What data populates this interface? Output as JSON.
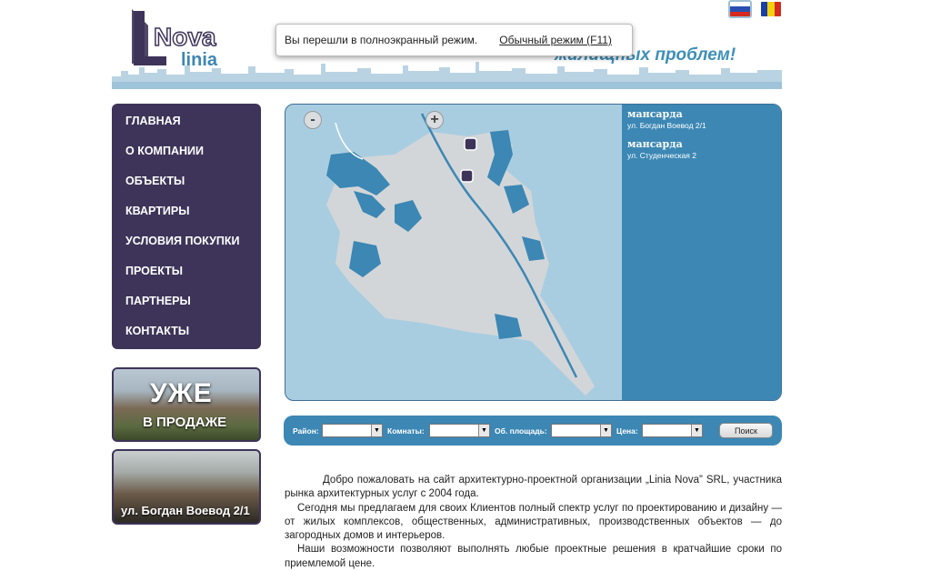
{
  "browser": {
    "fullscreen_notice": "Вы перешли в полноэкранный режим.",
    "normal_mode_link": "Обычный режим (F11)"
  },
  "header": {
    "logo_alt": "Nova Linia",
    "slogan": "жилищных проблем!",
    "languages": [
      "ru",
      "md"
    ]
  },
  "menu": {
    "items": [
      "ГЛАВНАЯ",
      "О КОМПАНИИ",
      "ОБЪЕКТЫ",
      "КВАРТИРЫ",
      "УСЛОВИЯ ПОКУПКИ",
      "ПРОЕКТЫ",
      "ПАРТНЕРЫ",
      "КОНТАКТЫ"
    ]
  },
  "banners": {
    "sale_line1": "УЖЕ",
    "sale_line2": "В ПРОДАЖЕ",
    "object_address": "ул. Богдан Воевод 2/1"
  },
  "map": {
    "zoom_out": "-",
    "zoom_in": "+",
    "objects": [
      {
        "title": "мансарда",
        "address": "ул. Богдан Воевод 2/1"
      },
      {
        "title": "мансарда",
        "address": "ул. Студенческая 2"
      }
    ]
  },
  "search": {
    "district_label": "Район:",
    "rooms_label": "Комнаты:",
    "area_label": "Об. площадь:",
    "price_label": "Цена:",
    "button": "Поиск",
    "district_value": "",
    "rooms_value": "",
    "area_value": "",
    "price_value": ""
  },
  "content": {
    "p1": "Добро пожаловать на сайт архитектурно-проектной организации „Linia Nova” SRL, участника рынка архитектурных услуг с 2004 года.",
    "p2": "Сегодня мы предлагаем для своих Клиентов полный спектр услуг по проектированию и дизайну — от жилых комплексов, общественных, административных, производственных объектов — до загородных домов и интерьеров.",
    "p3": "Наши возможности позволяют выполнять любые проектные решения в кратчайшие сроки по приемлемой цене."
  },
  "colors": {
    "menu_bg": "#3e3459",
    "accent_blue": "#3c87b4",
    "map_water": "#a9cde0"
  }
}
